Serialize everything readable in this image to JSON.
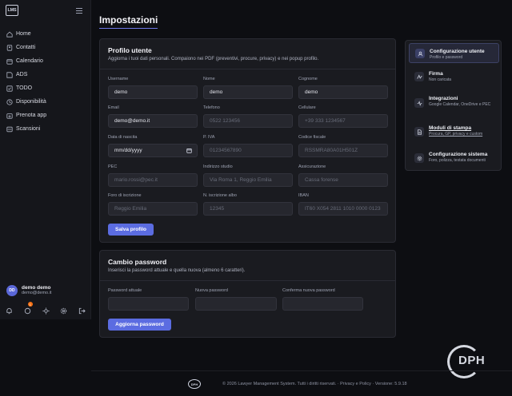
{
  "sidebar": {
    "logo": "LMS",
    "items": [
      {
        "label": "Home",
        "icon": "home-icon"
      },
      {
        "label": "Contatti",
        "icon": "contacts-icon"
      },
      {
        "label": "Calendario",
        "icon": "calendar-icon"
      },
      {
        "label": "ADS",
        "icon": "ads-icon"
      },
      {
        "label": "TODO",
        "icon": "todo-icon"
      },
      {
        "label": "Disponibilità",
        "icon": "availability-icon"
      },
      {
        "label": "Prenota app",
        "icon": "booking-icon"
      },
      {
        "label": "Scansioni",
        "icon": "scan-icon"
      }
    ],
    "user": {
      "initials": "DD",
      "name": "demo demo",
      "email": "demo@demo.it"
    },
    "notification_count": "1"
  },
  "page": {
    "title": "Impostazioni"
  },
  "profile": {
    "title": "Profilo utente",
    "subtitle": "Aggiorna i tuoi dati personali. Compaiono nei PDF (preventivi, procure, privacy) e nei popup profilo.",
    "fields": {
      "username": {
        "label": "Username",
        "value": "demo"
      },
      "nome": {
        "label": "Nome",
        "value": "demo"
      },
      "cognome": {
        "label": "Cognome",
        "value": "demo"
      },
      "email": {
        "label": "Email",
        "value": "demo@demo.it"
      },
      "telefono": {
        "label": "Telefono",
        "placeholder": "0522 123456"
      },
      "cellulare": {
        "label": "Cellulare",
        "placeholder": "+39 333 1234567"
      },
      "data_nascita": {
        "label": "Data di nascita",
        "value": "mm/dd/yyyy"
      },
      "piva": {
        "label": "P. IVA",
        "placeholder": "01234567890"
      },
      "cf": {
        "label": "Codice fiscale",
        "placeholder": "RSSMRA80A01H501Z"
      },
      "pec": {
        "label": "PEC",
        "placeholder": "mario.rossi@pec.it"
      },
      "indirizzo": {
        "label": "Indirizzo studio",
        "placeholder": "Via Roma 1, Reggio Emilia"
      },
      "assicurazione": {
        "label": "Assicurazione",
        "placeholder": "Cassa forense"
      },
      "foro": {
        "label": "Foro di iscrizione",
        "placeholder": "Reggio Emilia"
      },
      "albo": {
        "label": "N. iscrizione albo",
        "placeholder": "12345"
      },
      "iban": {
        "label": "IBAN",
        "placeholder": "IT60 X054 2811 1010 0000 0123"
      }
    },
    "save_label": "Salva profilo"
  },
  "password": {
    "title": "Cambio password",
    "subtitle": "Inserisci la password attuale e quella nuova (almeno 6 caratteri).",
    "current_label": "Password attuale",
    "new_label": "Nuova password",
    "confirm_label": "Conferma nuova password",
    "button_label": "Aggiorna password"
  },
  "settings_menu": [
    {
      "label": "Configurazione utente",
      "desc": "Profilo e password",
      "icon": "user-icon",
      "active": true
    },
    {
      "label": "Firma",
      "desc": "Non caricata",
      "icon": "signature-icon",
      "active": false
    },
    {
      "label": "Integrazioni",
      "desc": "Google Calendar, OneDrive e PEC",
      "icon": "integration-icon",
      "active": false
    },
    {
      "label": "Moduli di stampa",
      "desc": "Procura, GP, privacy e custom",
      "icon": "document-icon",
      "active": false
    },
    {
      "label": "Configurazione sistema",
      "desc": "Foro, polizza, testata documenti",
      "icon": "gear-icon",
      "active": false
    }
  ],
  "footer": {
    "logo": "DPH",
    "text": "© 2026 Lawyer Management System. Tutti i diritti riservati. · Privacy e Policy · Versione: 5.9.18"
  },
  "watermark": "DPH",
  "colors": {
    "accent": "#5b6ce1",
    "background": "#0d0e12",
    "card": "#1a1b20"
  }
}
